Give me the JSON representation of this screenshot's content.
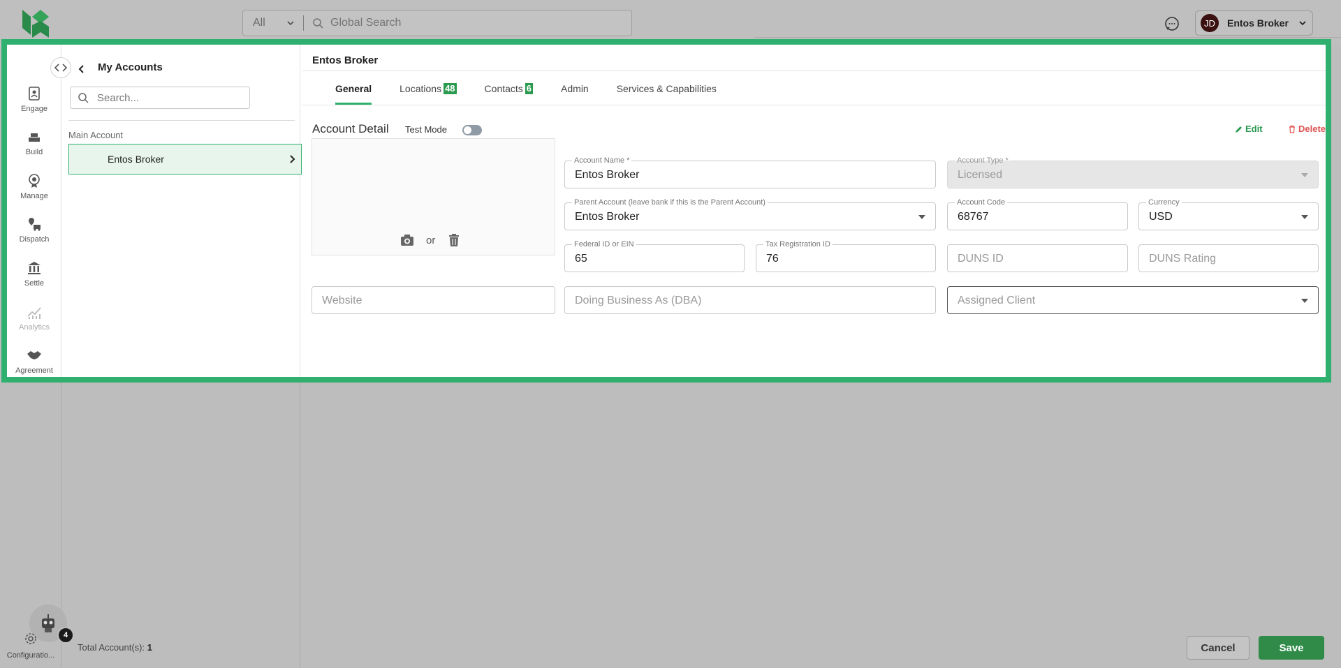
{
  "topbar": {
    "search_scope": "All",
    "search_placeholder": "Global Search",
    "user": {
      "initials": "JD",
      "name": "Entos Broker"
    }
  },
  "nav": {
    "items": [
      {
        "label": "Engage",
        "icon": "engage-icon"
      },
      {
        "label": "Build",
        "icon": "build-icon"
      },
      {
        "label": "Manage",
        "icon": "manage-icon"
      },
      {
        "label": "Dispatch",
        "icon": "dispatch-icon"
      },
      {
        "label": "Settle",
        "icon": "settle-icon"
      },
      {
        "label": "Analytics",
        "icon": "analytics-icon"
      },
      {
        "label": "Agreement",
        "icon": "agreement-icon"
      }
    ],
    "config_label": "Configuratio...",
    "notification_count": "4"
  },
  "accounts": {
    "title": "My Accounts",
    "search_placeholder": "Search...",
    "group_label": "Main Account",
    "items": [
      {
        "name": "Entos Broker"
      }
    ],
    "total_label": "Total Account(s):",
    "total_value": "1"
  },
  "detail": {
    "title": "Entos Broker",
    "tabs": [
      {
        "label": "General",
        "badge": ""
      },
      {
        "label": "Locations",
        "badge": "48"
      },
      {
        "label": "Contacts",
        "badge": "6"
      },
      {
        "label": "Admin",
        "badge": ""
      },
      {
        "label": "Services & Capabilities",
        "badge": ""
      }
    ],
    "section_title": "Account Detail",
    "test_mode_label": "Test Mode",
    "test_mode_on": false,
    "edit_label": "Edit",
    "delete_label": "Delete",
    "photo_or": "or",
    "fields": {
      "account_name": {
        "label": "Account Name *",
        "value": "Entos Broker"
      },
      "account_type": {
        "label": "Account Type *",
        "value": "Licensed"
      },
      "parent_account": {
        "label": "Parent Account (leave bank if this is the Parent Account)",
        "value": "Entos Broker"
      },
      "account_code": {
        "label": "Account Code",
        "value": "68767"
      },
      "currency": {
        "label": "Currency",
        "value": "USD"
      },
      "federal_id": {
        "label": "Federal ID or EIN",
        "value": "65"
      },
      "tax_id": {
        "label": "Tax Registration ID",
        "value": "76"
      },
      "duns_id": {
        "placeholder": "DUNS ID"
      },
      "duns_rating": {
        "placeholder": "DUNS Rating"
      },
      "website": {
        "placeholder": "Website"
      },
      "dba": {
        "placeholder": "Doing Business As (DBA)"
      },
      "assigned_client": {
        "placeholder": "Assigned Client"
      }
    }
  },
  "footer": {
    "cancel_label": "Cancel",
    "save_label": "Save"
  },
  "colors": {
    "accent": "#2fb06e",
    "brand_green": "#2a9a4f",
    "danger": "#e05555"
  }
}
